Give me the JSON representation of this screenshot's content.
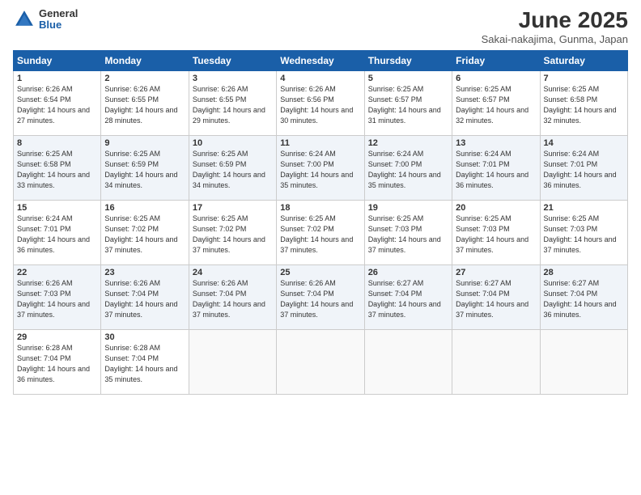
{
  "header": {
    "logo_general": "General",
    "logo_blue": "Blue",
    "month_title": "June 2025",
    "subtitle": "Sakai-nakajima, Gunma, Japan"
  },
  "days_of_week": [
    "Sunday",
    "Monday",
    "Tuesday",
    "Wednesday",
    "Thursday",
    "Friday",
    "Saturday"
  ],
  "weeks": [
    [
      {
        "day": 1,
        "sunrise": "6:26 AM",
        "sunset": "6:54 PM",
        "daylight": "14 hours and 27 minutes."
      },
      {
        "day": 2,
        "sunrise": "6:26 AM",
        "sunset": "6:55 PM",
        "daylight": "14 hours and 28 minutes."
      },
      {
        "day": 3,
        "sunrise": "6:26 AM",
        "sunset": "6:55 PM",
        "daylight": "14 hours and 29 minutes."
      },
      {
        "day": 4,
        "sunrise": "6:26 AM",
        "sunset": "6:56 PM",
        "daylight": "14 hours and 30 minutes."
      },
      {
        "day": 5,
        "sunrise": "6:25 AM",
        "sunset": "6:57 PM",
        "daylight": "14 hours and 31 minutes."
      },
      {
        "day": 6,
        "sunrise": "6:25 AM",
        "sunset": "6:57 PM",
        "daylight": "14 hours and 32 minutes."
      },
      {
        "day": 7,
        "sunrise": "6:25 AM",
        "sunset": "6:58 PM",
        "daylight": "14 hours and 32 minutes."
      }
    ],
    [
      {
        "day": 8,
        "sunrise": "6:25 AM",
        "sunset": "6:58 PM",
        "daylight": "14 hours and 33 minutes."
      },
      {
        "day": 9,
        "sunrise": "6:25 AM",
        "sunset": "6:59 PM",
        "daylight": "14 hours and 34 minutes."
      },
      {
        "day": 10,
        "sunrise": "6:25 AM",
        "sunset": "6:59 PM",
        "daylight": "14 hours and 34 minutes."
      },
      {
        "day": 11,
        "sunrise": "6:24 AM",
        "sunset": "7:00 PM",
        "daylight": "14 hours and 35 minutes."
      },
      {
        "day": 12,
        "sunrise": "6:24 AM",
        "sunset": "7:00 PM",
        "daylight": "14 hours and 35 minutes."
      },
      {
        "day": 13,
        "sunrise": "6:24 AM",
        "sunset": "7:01 PM",
        "daylight": "14 hours and 36 minutes."
      },
      {
        "day": 14,
        "sunrise": "6:24 AM",
        "sunset": "7:01 PM",
        "daylight": "14 hours and 36 minutes."
      }
    ],
    [
      {
        "day": 15,
        "sunrise": "6:24 AM",
        "sunset": "7:01 PM",
        "daylight": "14 hours and 36 minutes."
      },
      {
        "day": 16,
        "sunrise": "6:25 AM",
        "sunset": "7:02 PM",
        "daylight": "14 hours and 37 minutes."
      },
      {
        "day": 17,
        "sunrise": "6:25 AM",
        "sunset": "7:02 PM",
        "daylight": "14 hours and 37 minutes."
      },
      {
        "day": 18,
        "sunrise": "6:25 AM",
        "sunset": "7:02 PM",
        "daylight": "14 hours and 37 minutes."
      },
      {
        "day": 19,
        "sunrise": "6:25 AM",
        "sunset": "7:03 PM",
        "daylight": "14 hours and 37 minutes."
      },
      {
        "day": 20,
        "sunrise": "6:25 AM",
        "sunset": "7:03 PM",
        "daylight": "14 hours and 37 minutes."
      },
      {
        "day": 21,
        "sunrise": "6:25 AM",
        "sunset": "7:03 PM",
        "daylight": "14 hours and 37 minutes."
      }
    ],
    [
      {
        "day": 22,
        "sunrise": "6:26 AM",
        "sunset": "7:03 PM",
        "daylight": "14 hours and 37 minutes."
      },
      {
        "day": 23,
        "sunrise": "6:26 AM",
        "sunset": "7:04 PM",
        "daylight": "14 hours and 37 minutes."
      },
      {
        "day": 24,
        "sunrise": "6:26 AM",
        "sunset": "7:04 PM",
        "daylight": "14 hours and 37 minutes."
      },
      {
        "day": 25,
        "sunrise": "6:26 AM",
        "sunset": "7:04 PM",
        "daylight": "14 hours and 37 minutes."
      },
      {
        "day": 26,
        "sunrise": "6:27 AM",
        "sunset": "7:04 PM",
        "daylight": "14 hours and 37 minutes."
      },
      {
        "day": 27,
        "sunrise": "6:27 AM",
        "sunset": "7:04 PM",
        "daylight": "14 hours and 37 minutes."
      },
      {
        "day": 28,
        "sunrise": "6:27 AM",
        "sunset": "7:04 PM",
        "daylight": "14 hours and 36 minutes."
      }
    ],
    [
      {
        "day": 29,
        "sunrise": "6:28 AM",
        "sunset": "7:04 PM",
        "daylight": "14 hours and 36 minutes."
      },
      {
        "day": 30,
        "sunrise": "6:28 AM",
        "sunset": "7:04 PM",
        "daylight": "14 hours and 35 minutes."
      },
      null,
      null,
      null,
      null,
      null
    ]
  ]
}
